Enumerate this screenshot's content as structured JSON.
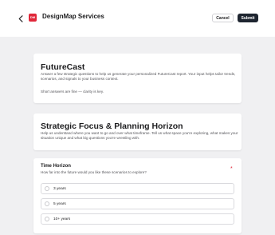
{
  "header": {
    "back_icon": "chevron-left-icon",
    "logo_text": "DM",
    "title": "DesignMap Services",
    "cancel_label": "Cancel",
    "submit_label": "Submit"
  },
  "intro": {
    "title": "FutureCast",
    "description": "Answer a few strategic questions to help us generate your personalized FutureCast report. Your input helps tailor trends, scenarios, and signals to your business context.",
    "note": "Short answers are fine — clarity is key."
  },
  "section": {
    "title": "Strategic Focus & Planning Horizon",
    "description": "Help us understand where you want to go and over what timeframe. Tell us what space you're exploring, what makes your situation unique and what big questions you're wrestling with."
  },
  "question": {
    "title": "Time Horizon",
    "help": "How far into the future would you like these scenarios to explore?",
    "required_mark": "*",
    "options": [
      {
        "label": "3 years"
      },
      {
        "label": "5 years"
      },
      {
        "label": "10+ years"
      }
    ]
  },
  "colors": {
    "background": "#f0f0f2",
    "brand": "#e0283a",
    "submit": "#1e2530"
  }
}
